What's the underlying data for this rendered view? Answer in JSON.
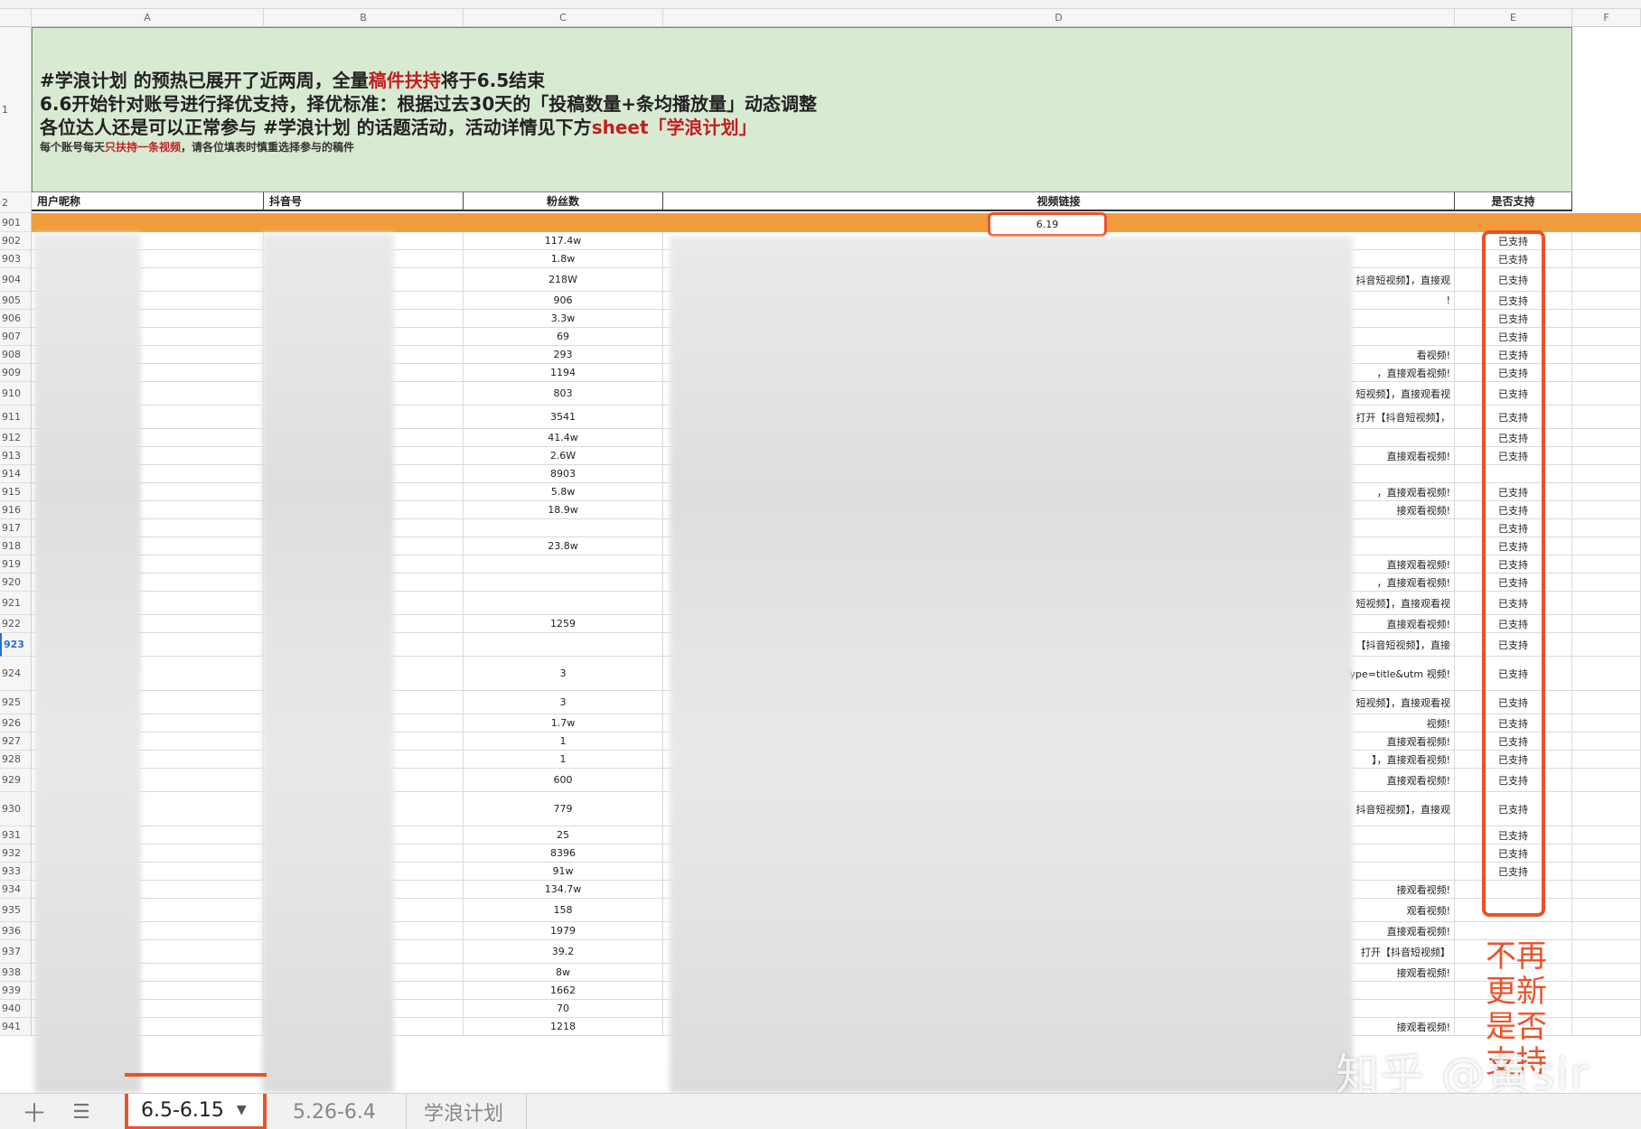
{
  "columns": [
    "A",
    "B",
    "C",
    "D",
    "E",
    "F"
  ],
  "banner": {
    "line1_a": "#学浪计划 的预热已展开了近两周，全量",
    "line1_red": "稿件扶持",
    "line1_b": "将于6.5结束",
    "line2": "6.6开始针对账号进行择优支持，择优标准：根据过去30天的「投稿数量+条均播放量」动态调整",
    "line3_a": "各位达人还是可以正常参与 #学浪计划 的话题活动，活动详情见下方",
    "line3_red": "sheet「学浪计划」",
    "small_a": "每个账号每天",
    "small_red": "只扶持一条视频",
    "small_b": "，请各位填表时慎重选择参与的稿件"
  },
  "header": {
    "row_no": "2",
    "col_a": "用户昵称",
    "col_b": "抖音号",
    "col_c": "粉丝数",
    "col_d": "视频链接",
    "col_e": "是否支持"
  },
  "date_row": {
    "row_no": "901",
    "date": "6.19"
  },
  "rows": [
    {
      "no": "902",
      "fans": "117.4w",
      "tail": "",
      "status": "已支持"
    },
    {
      "no": "903",
      "fans": "1.8w",
      "tail": "",
      "status": "已支持"
    },
    {
      "no": "904",
      "fans": "218W",
      "tail": "抖音短视频】，直接观",
      "status": "已支持"
    },
    {
      "no": "905",
      "fans": "906",
      "tail": "!",
      "status": "已支持"
    },
    {
      "no": "906",
      "fans": "3.3w",
      "tail": "",
      "status": "已支持"
    },
    {
      "no": "907",
      "fans": "69",
      "tail": "",
      "status": "已支持"
    },
    {
      "no": "908",
      "fans": "293",
      "tail": "看视频!",
      "status": "已支持"
    },
    {
      "no": "909",
      "fans": "1194",
      "tail": "，直接观看视频!",
      "status": "已支持"
    },
    {
      "no": "910",
      "fans": "803",
      "tail": "短视频】，直接观看视",
      "status": "已支持"
    },
    {
      "no": "911",
      "fans": "3541",
      "tail": "打开【抖音短视频】，",
      "status": "已支持"
    },
    {
      "no": "912",
      "fans": "41.4w",
      "tail": "",
      "status": "已支持"
    },
    {
      "no": "913",
      "fans": "2.6W",
      "tail": "直接观看视频!",
      "status": "已支持"
    },
    {
      "no": "914",
      "fans": "8903",
      "tail": "",
      "status": ""
    },
    {
      "no": "915",
      "fans": "5.8w",
      "tail": "，直接观看视频!",
      "status": "已支持"
    },
    {
      "no": "916",
      "fans": "18.9w",
      "tail": "接观看视频!",
      "status": "已支持"
    },
    {
      "no": "917",
      "fans": "",
      "tail": "",
      "status": "已支持"
    },
    {
      "no": "918",
      "fans": "23.8w",
      "tail": "",
      "status": "已支持"
    },
    {
      "no": "919",
      "fans": "",
      "tail": "直接观看视频!",
      "status": "已支持"
    },
    {
      "no": "920",
      "fans": "",
      "tail": "，直接观看视频!",
      "status": "已支持"
    },
    {
      "no": "921",
      "fans": "",
      "tail": "短视频】，直接观看视",
      "status": "已支持"
    },
    {
      "no": "922",
      "fans": "1259",
      "tail": "直接观看视频!",
      "status": "已支持"
    },
    {
      "no": "923",
      "fans": "",
      "tail": "【抖音短视频】，直接",
      "status": "已支持"
    },
    {
      "no": "924",
      "fans": "3",
      "tail": "titleType=title&utm 视频!",
      "status": "已支持"
    },
    {
      "no": "925",
      "fans": "3",
      "tail": "短视频】，直接观看视",
      "status": "已支持"
    },
    {
      "no": "926",
      "fans": "1.7w",
      "tail": "视频!",
      "status": "已支持"
    },
    {
      "no": "927",
      "fans": "1",
      "tail": "直接观看视频!",
      "status": "已支持"
    },
    {
      "no": "928",
      "fans": "1",
      "tail": "】，直接观看视频!",
      "status": "已支持"
    },
    {
      "no": "929",
      "fans": "600",
      "tail": "直接观看视频!",
      "status": "已支持"
    },
    {
      "no": "930",
      "fans": "779",
      "tail": "抖音短视频】，直接观",
      "status": "已支持"
    },
    {
      "no": "931",
      "fans": "25",
      "tail": "",
      "status": "已支持"
    },
    {
      "no": "932",
      "fans": "8396",
      "tail": "",
      "status": "已支持"
    },
    {
      "no": "933",
      "fans": "91w",
      "tail": "",
      "status": "已支持"
    },
    {
      "no": "934",
      "fans": "134.7w",
      "tail": "接观看视频!",
      "status": ""
    },
    {
      "no": "935",
      "fans": "158",
      "tail": "观看视频!",
      "status": ""
    },
    {
      "no": "936",
      "fans": "1979",
      "tail": "直接观看视频!",
      "status": ""
    },
    {
      "no": "937",
      "fans": "39.2",
      "tail": "打开【抖音短视频】",
      "status": ""
    },
    {
      "no": "938",
      "fans": "8w",
      "tail": "接观看视频!",
      "status": ""
    },
    {
      "no": "939",
      "fans": "1662",
      "tail": "",
      "status": ""
    },
    {
      "no": "940",
      "fans": "70",
      "tail": "",
      "status": ""
    },
    {
      "no": "941",
      "fans": "1218",
      "tail": "接观看视频!",
      "status": ""
    }
  ],
  "annotation": "不再更新是否支持",
  "watermark": "知乎 @黄sir",
  "tabs": {
    "add_icon": "plus-icon",
    "list_icon": "list-icon",
    "items": [
      {
        "label": "6.5-6.15",
        "active": true
      },
      {
        "label": "5.26-6.4",
        "active": false
      },
      {
        "label": "学浪计划",
        "active": false
      }
    ]
  },
  "colors": {
    "banner_bg": "#d9ead3",
    "date_row": "#f19c3c",
    "highlight": "#e8542a",
    "red_text": "#c21f1f"
  }
}
